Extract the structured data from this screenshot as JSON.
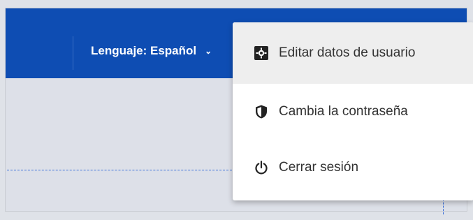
{
  "header": {
    "language_selector": "Lenguaje: Español",
    "language_chevron": "chevron-down-icon"
  },
  "user_menu": {
    "items": [
      {
        "label": "Editar datos de usuario",
        "icon": "user-settings-icon",
        "active": true
      },
      {
        "label": "Cambia la contraseña",
        "icon": "shield-icon",
        "active": false
      },
      {
        "label": "Cerrar sesión",
        "icon": "power-icon",
        "active": false
      }
    ]
  },
  "colors": {
    "topbar": "#0e4db3",
    "menu_active_bg": "#eeeeee",
    "menu_text": "#333333",
    "dashed_accent": "#3a6ed8"
  }
}
